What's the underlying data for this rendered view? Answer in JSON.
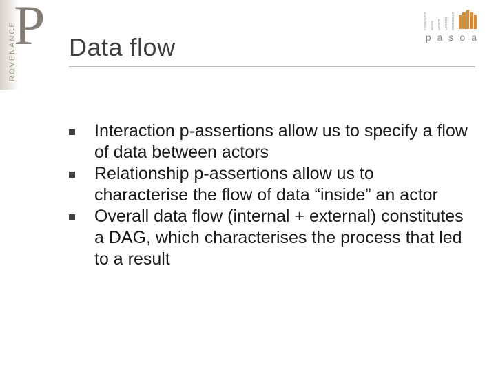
{
  "left_logo": {
    "vertical_text": "ROVENANCE",
    "big_letter": "P"
  },
  "right_logo": {
    "words": [
      "Provenance",
      "Aware",
      "Service",
      "Oriented",
      "Architecture"
    ],
    "letters": [
      "p",
      "a",
      "s",
      "o",
      "a"
    ]
  },
  "heading": "Data flow",
  "bullets": [
    "Interaction p-assertions allow us to specify a flow of data between actors",
    "Relationship p-assertions allow us to characterise the flow of data “inside” an actor",
    "Overall data flow (internal + external) constitutes a DAG, which characterises the process that led to a result"
  ]
}
